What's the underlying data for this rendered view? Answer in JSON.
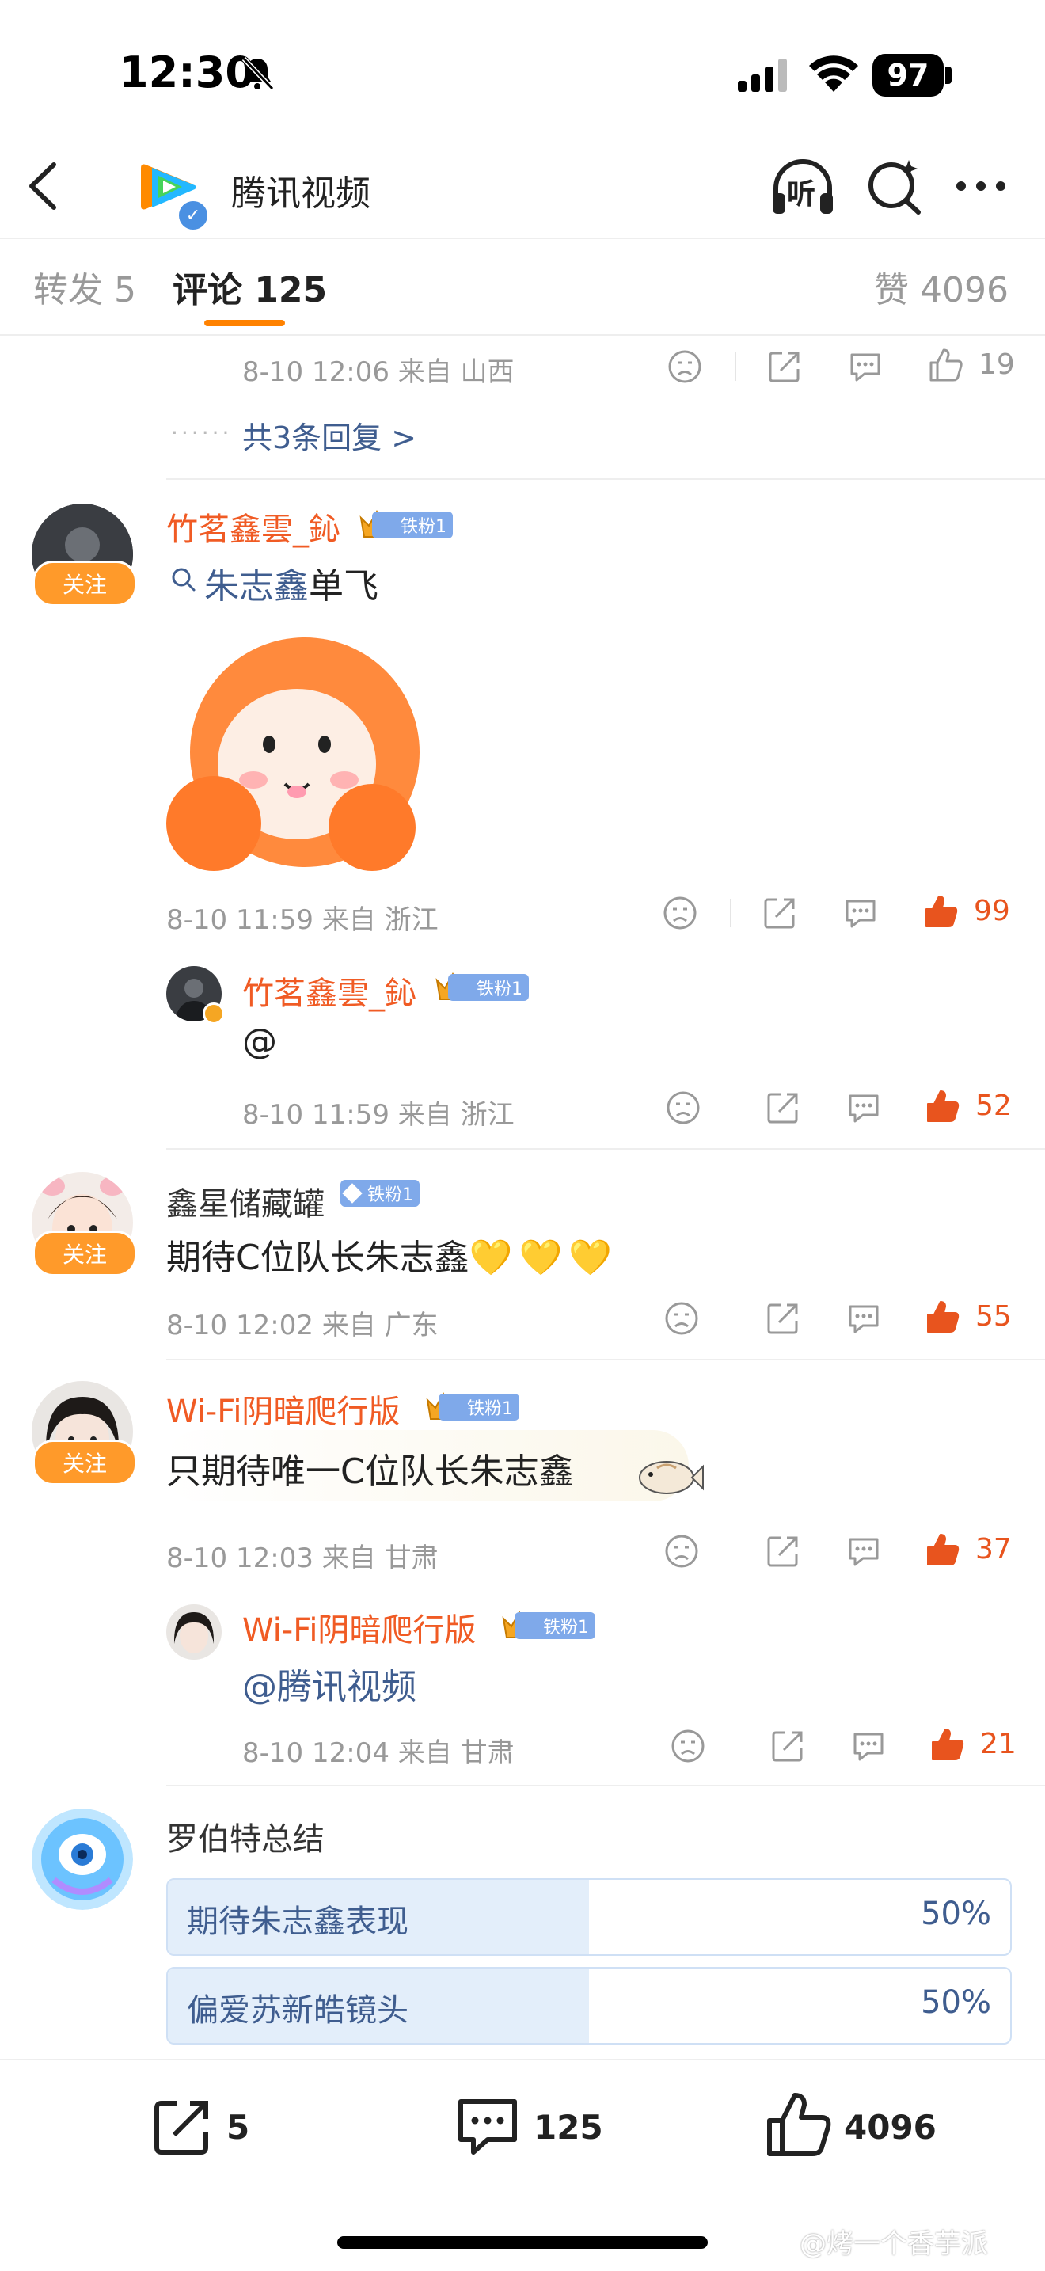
{
  "status_bar": {
    "time": "12:30",
    "battery": "97"
  },
  "header": {
    "title": "腾讯视频",
    "listen_label": "听"
  },
  "tabs": {
    "repost": "转发 5",
    "comments": "评论 125",
    "likes": "赞 4096"
  },
  "top_reply": {
    "meta": "8-10 12:06 来自 山西",
    "likes": "19",
    "more_replies": "共3条回复 >"
  },
  "comments": [
    {
      "user": "竹茗鑫雲_鈊",
      "badge": "铁粉1",
      "follow": "关注",
      "text_prefix": "朱志鑫",
      "text_suffix": "单飞",
      "meta": "8-10 11:59 来自 浙江",
      "likes": "99",
      "reply": {
        "user": "竹茗鑫雲_鈊",
        "badge": "铁粉1",
        "text": "@",
        "meta": "8-10 11:59 来自 浙江",
        "likes": "52"
      }
    },
    {
      "user": "鑫星储藏罐",
      "badge": "铁粉1",
      "follow": "关注",
      "text": "期待C位队长朱志鑫",
      "emoji": "💛💛💛",
      "meta": "8-10 12:02 来自 广东",
      "likes": "55"
    },
    {
      "user": "Wi-Fi阴暗爬行版",
      "badge": "铁粉1",
      "follow": "关注",
      "text": "只期待唯一C位队长朱志鑫",
      "meta": "8-10 12:03 来自 甘肃",
      "likes": "37",
      "reply": {
        "user": "Wi-Fi阴暗爬行版",
        "badge": "铁粉1",
        "text": "@腾讯视频",
        "meta": "8-10 12:04 来自 甘肃",
        "likes": "21"
      }
    }
  ],
  "poll": {
    "author": "罗伯特总结",
    "options": [
      {
        "label": "期待朱志鑫表现",
        "percent_text": "50%",
        "fraction": 0.5
      },
      {
        "label": "偏爱苏新皓镜头",
        "percent_text": "50%",
        "fraction": 0.5
      }
    ]
  },
  "bottom_bar": {
    "reposts": "5",
    "comments": "125",
    "likes": "4096"
  },
  "watermark": "@烤一个香芋派",
  "colors": {
    "accent": "#ff8200",
    "name_orange": "#f05b24",
    "like_orange": "#e8541e",
    "link_blue": "#3f5d8f"
  }
}
